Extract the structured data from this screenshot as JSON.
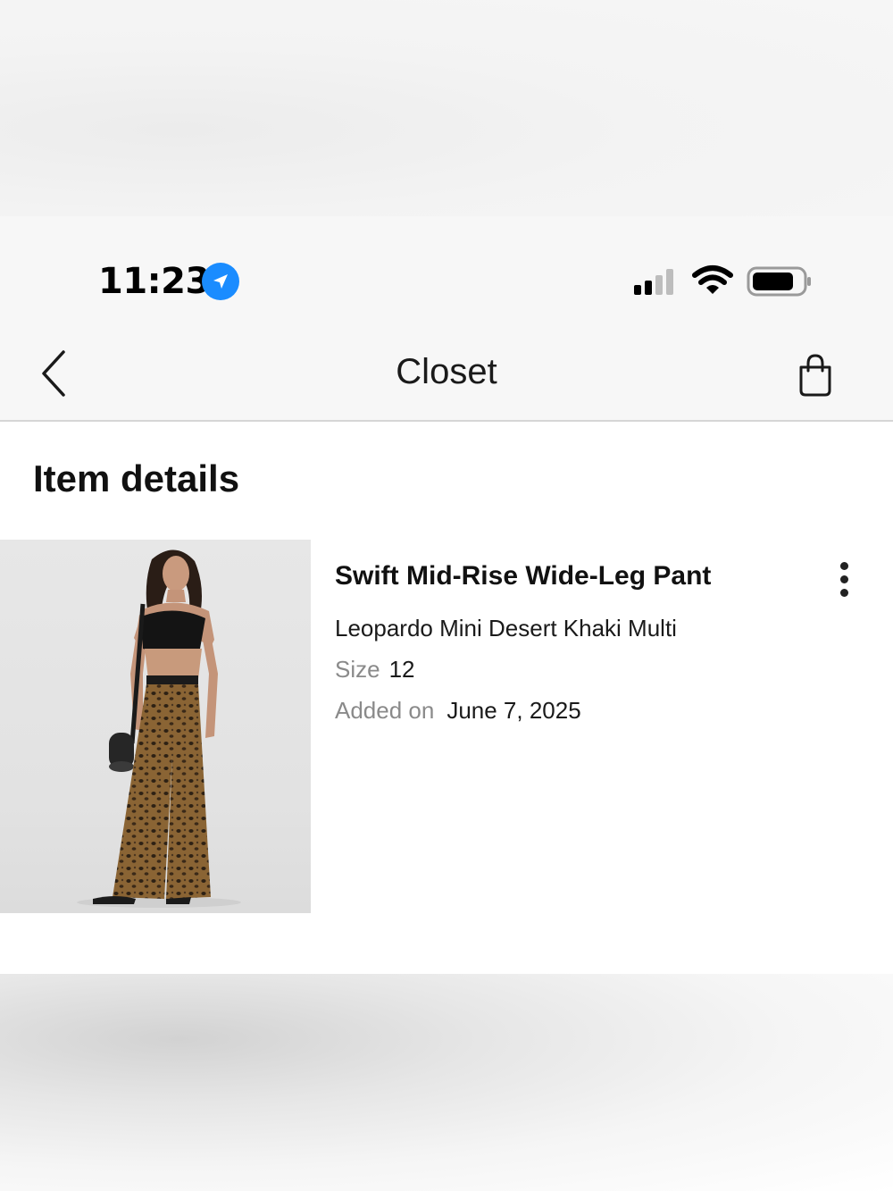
{
  "status_bar": {
    "time": "11:23",
    "icons": [
      "location-arrow-icon",
      "cellular-signal-icon",
      "wifi-icon",
      "battery-icon"
    ]
  },
  "nav": {
    "title": "Closet",
    "back_icon": "chevron-left-icon",
    "bag_icon": "shopping-bag-icon"
  },
  "section": {
    "title": "Item details"
  },
  "item": {
    "name": "Swift Mid-Rise Wide-Leg Pant",
    "color": "Leopardo Mini Desert Khaki Multi",
    "size_label": "Size",
    "size_value": "12",
    "added_label": "Added on",
    "added_value": "June 7, 2025",
    "menu_icon": "more-vertical-icon"
  },
  "colors": {
    "accent_blue": "#1a8cff",
    "label_gray": "#8a8a8a"
  }
}
